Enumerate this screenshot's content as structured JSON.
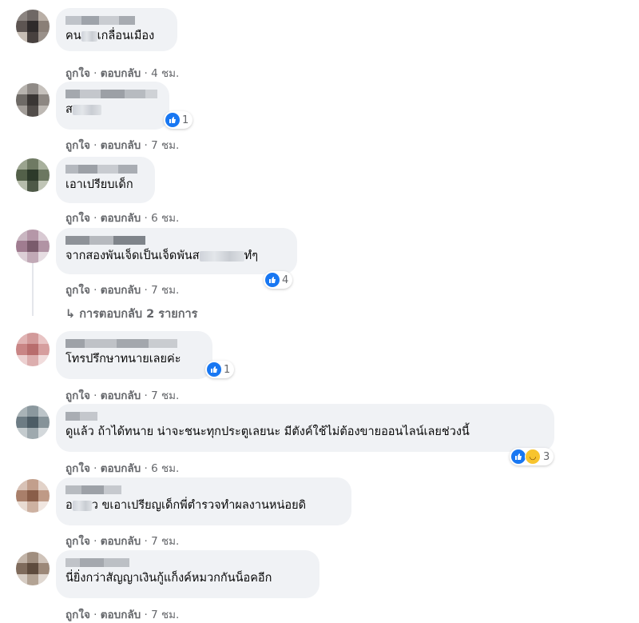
{
  "comments": [
    {
      "text_a": "คน",
      "text_b": "เกลื่อนเมือง",
      "actions": {
        "like": "ถูกใจ",
        "sep": "·",
        "reply": "ตอบกลับ",
        "time": "4 ชม."
      }
    },
    {
      "text_a": "ส",
      "text_b": "",
      "reactions": "1",
      "actions": {
        "like": "ถูกใจ",
        "sep": "·",
        "reply": "ตอบกลับ",
        "time": "7 ชม."
      }
    },
    {
      "text_a": "เอาเปรียบเด็ก",
      "actions": {
        "like": "ถูกใจ",
        "sep": "·",
        "reply": "ตอบกลับ",
        "time": "6 ชม."
      }
    },
    {
      "text_a": "จากสองพันเจ็ดเป็นเจ็ดพันส",
      "text_b": "ทํๆ",
      "reactions": "4",
      "actions": {
        "like": "ถูกใจ",
        "sep": "·",
        "reply": "ตอบกลับ",
        "time": "7 ชม."
      }
    },
    {
      "text_a": "โทรปรึกษาทนายเลยค่ะ",
      "reactions": "1",
      "actions": {
        "like": "ถูกใจ",
        "sep": "·",
        "reply": "ตอบกลับ",
        "time": "7 ชม."
      }
    },
    {
      "text_a": "ดูแล้ว ถ้าได้ทนาย น่าจะชนะทุกประตูเลยนะ มีตังค์ใช้ไม่ต้องขายออนไลน์เลยช่วงนี้",
      "reactions": "3",
      "actions": {
        "like": "ถูกใจ",
        "sep": "·",
        "reply": "ตอบกลับ",
        "time": "6 ชม."
      }
    },
    {
      "text_a": "อ",
      "text_b": "ว ขเอาเปรียญเด็กพี่ตำรวจทำผลงานหน่อยดิ",
      "actions": {
        "like": "ถูกใจ",
        "sep": "·",
        "reply": "ตอบกลับ",
        "time": "7 ชม."
      }
    },
    {
      "text_a": "นี่ยิ่งกว่าสัญญาเงินกู้แก็งค์หมวกกันน็อคอีก",
      "actions": {
        "like": "ถูกใจ",
        "sep": "·",
        "reply": "ตอบกลับ",
        "time": "7 ชม."
      }
    }
  ],
  "replies": {
    "arrow": "↳",
    "label": "การตอบกลับ 2 รายการ"
  },
  "colors": {
    "like_blue": "#1877f2",
    "bubble": "#f0f2f5",
    "meta": "#65676b",
    "haha": "#f7c42e"
  },
  "icons": [
    "like-icon",
    "haha-icon",
    "reply-arrow-icon"
  ]
}
